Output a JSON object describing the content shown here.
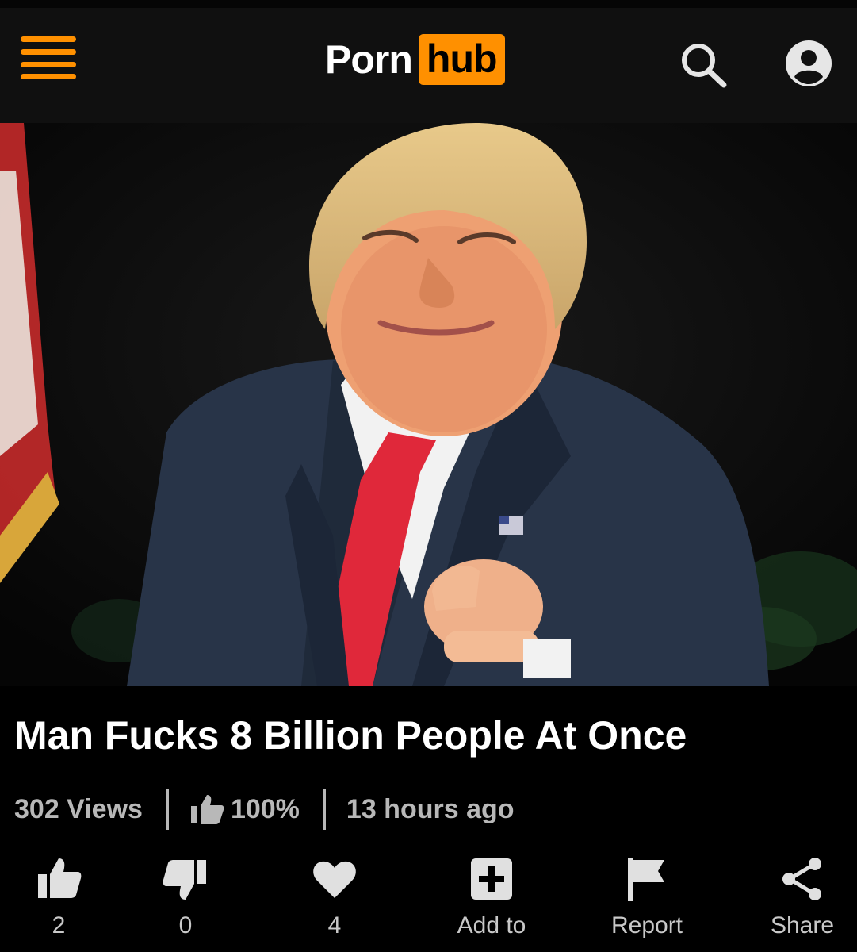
{
  "header": {
    "logo_text_1": "Porn",
    "logo_text_2": "hub",
    "accent_color": "#ff9000",
    "icons": [
      "menu-icon",
      "search-icon",
      "user-icon"
    ]
  },
  "video": {
    "thumbnail": "man-in-suit-pointing-image",
    "title": "Man Fucks 8 Billion People At Once"
  },
  "stats": {
    "views": "302 Views",
    "rating": "100%",
    "age": "13 hours ago"
  },
  "actions": [
    {
      "icon": "thumbs-up-icon",
      "label": "2"
    },
    {
      "icon": "thumbs-down-icon",
      "label": "0"
    },
    {
      "icon": "heart-icon",
      "label": "4"
    },
    {
      "icon": "add-icon",
      "label": "Add to"
    },
    {
      "icon": "flag-icon",
      "label": "Report"
    },
    {
      "icon": "share-icon",
      "label": "Share"
    }
  ]
}
